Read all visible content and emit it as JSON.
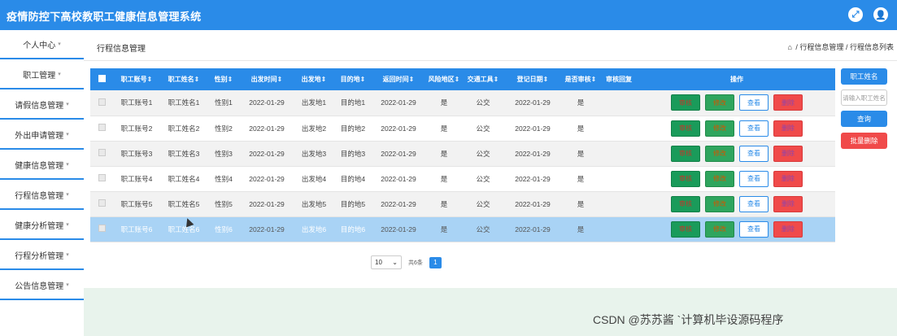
{
  "app": {
    "title": "疫情防控下高校教职工健康信息管理系统"
  },
  "sidebar": {
    "items": [
      {
        "label": "个人中心"
      },
      {
        "label": "职工管理"
      },
      {
        "label": "请假信息管理"
      },
      {
        "label": "外出申请管理"
      },
      {
        "label": "健康信息管理"
      },
      {
        "label": "行程信息管理"
      },
      {
        "label": "健康分析管理"
      },
      {
        "label": "行程分析管理"
      },
      {
        "label": "公告信息管理"
      }
    ]
  },
  "header": {
    "page_title": "行程信息管理",
    "breadcrumb": [
      "行程信息管理",
      "行程信息列表"
    ],
    "breadcrumb_sep": "/"
  },
  "table": {
    "columns": [
      "职工账号",
      "职工姓名",
      "性别",
      "出发时间",
      "出发地",
      "目的地",
      "返回时间",
      "风险地区",
      "交通工具",
      "登记日期",
      "是否审核",
      "审核回复",
      "操作"
    ],
    "sortable": [
      true,
      true,
      true,
      true,
      true,
      true,
      true,
      true,
      true,
      true,
      true,
      false,
      false
    ],
    "sort_icon": "⇕",
    "rows": [
      {
        "account": "职工账号1",
        "name": "职工姓名1",
        "gender": "性别1",
        "depart_time": "2022-01-29",
        "origin": "出发地1",
        "destination": "目的地1",
        "return_time": "2022-01-29",
        "risk": "是",
        "transport": "公交",
        "reg_date": "2022-01-29",
        "reviewed": "是",
        "reply": ""
      },
      {
        "account": "职工账号2",
        "name": "职工姓名2",
        "gender": "性别2",
        "depart_time": "2022-01-29",
        "origin": "出发地2",
        "destination": "目的地2",
        "return_time": "2022-01-29",
        "risk": "是",
        "transport": "公交",
        "reg_date": "2022-01-29",
        "reviewed": "是",
        "reply": ""
      },
      {
        "account": "职工账号3",
        "name": "职工姓名3",
        "gender": "性别3",
        "depart_time": "2022-01-29",
        "origin": "出发地3",
        "destination": "目的地3",
        "return_time": "2022-01-29",
        "risk": "是",
        "transport": "公交",
        "reg_date": "2022-01-29",
        "reviewed": "是",
        "reply": ""
      },
      {
        "account": "职工账号4",
        "name": "职工姓名4",
        "gender": "性别4",
        "depart_time": "2022-01-29",
        "origin": "出发地4",
        "destination": "目的地4",
        "return_time": "2022-01-29",
        "risk": "是",
        "transport": "公交",
        "reg_date": "2022-01-29",
        "reviewed": "是",
        "reply": ""
      },
      {
        "account": "职工账号5",
        "name": "职工姓名5",
        "gender": "性别5",
        "depart_time": "2022-01-29",
        "origin": "出发地5",
        "destination": "目的地5",
        "return_time": "2022-01-29",
        "risk": "是",
        "transport": "公交",
        "reg_date": "2022-01-29",
        "reviewed": "是",
        "reply": ""
      },
      {
        "account": "职工账号6",
        "name": "职工姓名6",
        "gender": "性别6",
        "depart_time": "2022-01-29",
        "origin": "出发地6",
        "destination": "目的地6",
        "return_time": "2022-01-29",
        "risk": "是",
        "transport": "公交",
        "reg_date": "2022-01-29",
        "reviewed": "是",
        "reply": ""
      }
    ],
    "actions": {
      "approve": "审核",
      "edit": "修改",
      "view": "查看",
      "delete": "删除"
    }
  },
  "pagination": {
    "page_size": "10",
    "total_text": "共6条",
    "current_page": "1"
  },
  "search": {
    "label": "职工姓名",
    "placeholder": "请输入职工姓名",
    "query_button": "查询",
    "bulk_delete_button": "批量删除"
  },
  "watermark": "CSDN @苏苏酱 `计算机毕设源码程序",
  "colors": {
    "primary": "#2a8be8",
    "danger": "#f04a4a",
    "success": "#1a9b5a",
    "selected_row": "#a9d3f5"
  }
}
